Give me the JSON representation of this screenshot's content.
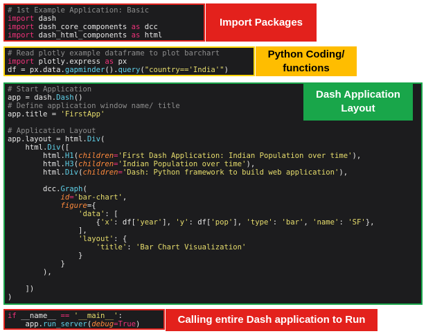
{
  "sections": {
    "imports": {
      "label": "Import Packages",
      "lines": [
        {
          "parts": [
            {
              "t": "# 1st Example Application: Basic",
              "c": "c"
            }
          ]
        },
        {
          "parts": [
            {
              "t": "import",
              "c": "k"
            },
            {
              "t": " dash",
              "c": ""
            }
          ]
        },
        {
          "parts": [
            {
              "t": "import",
              "c": "k"
            },
            {
              "t": " dash_core_components ",
              "c": ""
            },
            {
              "t": "as",
              "c": "k"
            },
            {
              "t": " dcc",
              "c": ""
            }
          ]
        },
        {
          "parts": [
            {
              "t": "import",
              "c": "k"
            },
            {
              "t": " dash_html_components ",
              "c": ""
            },
            {
              "t": "as",
              "c": "k"
            },
            {
              "t": " html",
              "c": ""
            }
          ]
        }
      ]
    },
    "coding": {
      "label_lines": [
        "Python Coding/",
        "functions"
      ],
      "lines": [
        {
          "parts": [
            {
              "t": "# Read plotly example dataframe to plot barchart",
              "c": "c"
            }
          ]
        },
        {
          "parts": [
            {
              "t": "import",
              "c": "k"
            },
            {
              "t": " plotly.express ",
              "c": ""
            },
            {
              "t": "as",
              "c": "k"
            },
            {
              "t": " px",
              "c": ""
            }
          ]
        },
        {
          "parts": [
            {
              "t": "df = px.data.",
              "c": ""
            },
            {
              "t": "gapminder",
              "c": "f"
            },
            {
              "t": "().",
              "c": ""
            },
            {
              "t": "query",
              "c": "f"
            },
            {
              "t": "(",
              "c": ""
            },
            {
              "t": "\"country=='India'\"",
              "c": "s"
            },
            {
              "t": ")",
              "c": ""
            }
          ]
        }
      ]
    },
    "layout": {
      "label_lines": [
        "Dash Application",
        "Layout"
      ],
      "lines": [
        {
          "parts": [
            {
              "t": "# Start Application",
              "c": "c"
            }
          ]
        },
        {
          "parts": [
            {
              "t": "app = dash.",
              "c": ""
            },
            {
              "t": "Dash",
              "c": "f"
            },
            {
              "t": "()",
              "c": ""
            }
          ]
        },
        {
          "parts": [
            {
              "t": "# Define application window name/ title",
              "c": "c"
            }
          ]
        },
        {
          "parts": [
            {
              "t": "app.title = ",
              "c": ""
            },
            {
              "t": "'FirstApp'",
              "c": "s"
            }
          ]
        },
        {
          "parts": [
            {
              "t": "",
              "c": ""
            }
          ]
        },
        {
          "parts": [
            {
              "t": "# Application Layout",
              "c": "c"
            }
          ]
        },
        {
          "parts": [
            {
              "t": "app.layout = html.",
              "c": ""
            },
            {
              "t": "Div",
              "c": "f"
            },
            {
              "t": "(",
              "c": ""
            }
          ]
        },
        {
          "parts": [
            {
              "t": "    html.",
              "c": ""
            },
            {
              "t": "Div",
              "c": "f"
            },
            {
              "t": "([",
              "c": ""
            }
          ]
        },
        {
          "parts": [
            {
              "t": "        html.",
              "c": ""
            },
            {
              "t": "H1",
              "c": "f"
            },
            {
              "t": "(",
              "c": ""
            },
            {
              "t": "children",
              "c": "p"
            },
            {
              "t": "=",
              "c": "k"
            },
            {
              "t": "'First Dash Application: Indian Population over time'",
              "c": "s"
            },
            {
              "t": "),",
              "c": ""
            }
          ]
        },
        {
          "parts": [
            {
              "t": "        html.",
              "c": ""
            },
            {
              "t": "H3",
              "c": "f"
            },
            {
              "t": "(",
              "c": ""
            },
            {
              "t": "children",
              "c": "p"
            },
            {
              "t": "=",
              "c": "k"
            },
            {
              "t": "'Indian Population over time'",
              "c": "s"
            },
            {
              "t": "),",
              "c": ""
            }
          ]
        },
        {
          "parts": [
            {
              "t": "        html.",
              "c": ""
            },
            {
              "t": "Div",
              "c": "f"
            },
            {
              "t": "(",
              "c": ""
            },
            {
              "t": "children",
              "c": "p"
            },
            {
              "t": "=",
              "c": "k"
            },
            {
              "t": "'Dash: Python framework to build web application'",
              "c": "s"
            },
            {
              "t": "),",
              "c": ""
            }
          ]
        },
        {
          "parts": [
            {
              "t": "",
              "c": ""
            }
          ]
        },
        {
          "parts": [
            {
              "t": "        dcc.",
              "c": ""
            },
            {
              "t": "Graph",
              "c": "f"
            },
            {
              "t": "(",
              "c": ""
            }
          ]
        },
        {
          "parts": [
            {
              "t": "            ",
              "c": ""
            },
            {
              "t": "id",
              "c": "p"
            },
            {
              "t": "=",
              "c": "k"
            },
            {
              "t": "'bar-chart'",
              "c": "s"
            },
            {
              "t": ",",
              "c": ""
            }
          ]
        },
        {
          "parts": [
            {
              "t": "            ",
              "c": ""
            },
            {
              "t": "figure",
              "c": "p"
            },
            {
              "t": "={",
              "c": ""
            }
          ]
        },
        {
          "parts": [
            {
              "t": "                ",
              "c": ""
            },
            {
              "t": "'data'",
              "c": "s"
            },
            {
              "t": ": [",
              "c": ""
            }
          ]
        },
        {
          "parts": [
            {
              "t": "                    {",
              "c": ""
            },
            {
              "t": "'x'",
              "c": "s"
            },
            {
              "t": ": df[",
              "c": ""
            },
            {
              "t": "'year'",
              "c": "s"
            },
            {
              "t": "], ",
              "c": ""
            },
            {
              "t": "'y'",
              "c": "s"
            },
            {
              "t": ": df[",
              "c": ""
            },
            {
              "t": "'pop'",
              "c": "s"
            },
            {
              "t": "], ",
              "c": ""
            },
            {
              "t": "'type'",
              "c": "s"
            },
            {
              "t": ": ",
              "c": ""
            },
            {
              "t": "'bar'",
              "c": "s"
            },
            {
              "t": ", ",
              "c": ""
            },
            {
              "t": "'name'",
              "c": "s"
            },
            {
              "t": ": ",
              "c": ""
            },
            {
              "t": "'SF'",
              "c": "s"
            },
            {
              "t": "},",
              "c": ""
            }
          ]
        },
        {
          "parts": [
            {
              "t": "                ],",
              "c": ""
            }
          ]
        },
        {
          "parts": [
            {
              "t": "                ",
              "c": ""
            },
            {
              "t": "'layout'",
              "c": "s"
            },
            {
              "t": ": {",
              "c": ""
            }
          ]
        },
        {
          "parts": [
            {
              "t": "                    ",
              "c": ""
            },
            {
              "t": "'title'",
              "c": "s"
            },
            {
              "t": ": ",
              "c": ""
            },
            {
              "t": "'Bar Chart Visualization'",
              "c": "s"
            }
          ]
        },
        {
          "parts": [
            {
              "t": "                }",
              "c": ""
            }
          ]
        },
        {
          "parts": [
            {
              "t": "            }",
              "c": ""
            }
          ]
        },
        {
          "parts": [
            {
              "t": "        ),",
              "c": ""
            }
          ]
        },
        {
          "parts": [
            {
              "t": "",
              "c": ""
            }
          ]
        },
        {
          "parts": [
            {
              "t": "    ])",
              "c": ""
            }
          ]
        },
        {
          "parts": [
            {
              "t": ")",
              "c": ""
            }
          ]
        }
      ]
    },
    "run": {
      "label": "Calling entire Dash application to Run",
      "lines": [
        {
          "parts": [
            {
              "t": "if",
              "c": "k"
            },
            {
              "t": " __name__ ",
              "c": ""
            },
            {
              "t": "==",
              "c": "k"
            },
            {
              "t": " ",
              "c": ""
            },
            {
              "t": "'__main__'",
              "c": "s"
            },
            {
              "t": ":",
              "c": ""
            }
          ]
        },
        {
          "parts": [
            {
              "t": "    app.",
              "c": ""
            },
            {
              "t": "run_server",
              "c": "f"
            },
            {
              "t": "(",
              "c": ""
            },
            {
              "t": "debug",
              "c": "p"
            },
            {
              "t": "=",
              "c": "k"
            },
            {
              "t": "True",
              "c": "k"
            },
            {
              "t": ")",
              "c": ""
            }
          ]
        }
      ]
    }
  },
  "colors": {
    "red": "#e3211c",
    "yellow": "#ffd400",
    "orange_label": "#ffbd00",
    "green": "#19a64a",
    "code_background": "#1c1c1e"
  }
}
